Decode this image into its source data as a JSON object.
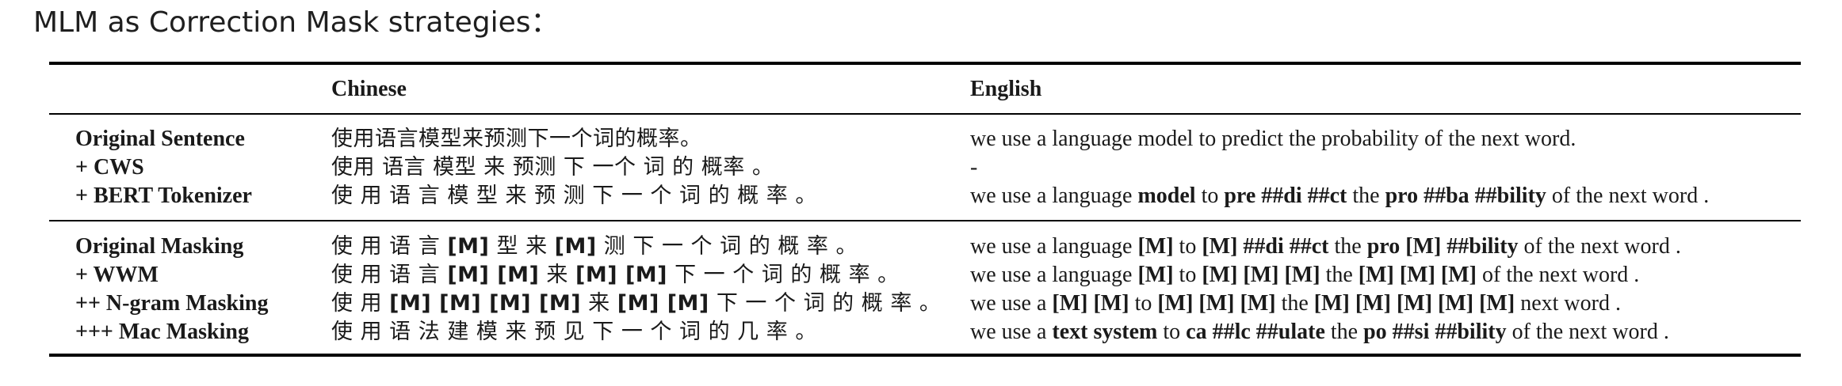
{
  "heading": "MLM as Correction Mask strategies：",
  "table": {
    "headers": {
      "label": "",
      "chinese": "Chinese",
      "english": "English"
    },
    "group1": [
      {
        "label": "Original Sentence",
        "zh": [
          {
            "t": "使用语言模型来预测下一个词的概率。",
            "b": false
          }
        ],
        "en": [
          {
            "t": "we use a language model to predict the probability of the next word.",
            "b": false
          }
        ]
      },
      {
        "label": "+ CWS",
        "zh": [
          {
            "t": "使用 语言 模型 来 预测 下 一个 词 的 概率 。",
            "b": false
          }
        ],
        "en": [
          {
            "t": "-",
            "b": false
          }
        ]
      },
      {
        "label": "+ BERT Tokenizer",
        "zh": [
          {
            "t": "使 用 语 言 模 型 来 预 测 下 一 个 词 的 概 率 。",
            "b": false
          }
        ],
        "en": [
          {
            "t": "we use a language ",
            "b": false
          },
          {
            "t": "model",
            "b": true
          },
          {
            "t": " to ",
            "b": false
          },
          {
            "t": "pre ##di ##ct",
            "b": true
          },
          {
            "t": " the ",
            "b": false
          },
          {
            "t": "pro ##ba ##bility",
            "b": true
          },
          {
            "t": " of the next word .",
            "b": false
          }
        ]
      }
    ],
    "group2": [
      {
        "label": "Original Masking",
        "zh": [
          {
            "t": "使 用 语 言 ",
            "b": false
          },
          {
            "t": "[M]",
            "b": true
          },
          {
            "t": " 型 来 ",
            "b": false
          },
          {
            "t": "[M]",
            "b": true
          },
          {
            "t": " 测 下 一 个 词 的 概 率 。",
            "b": false
          }
        ],
        "en": [
          {
            "t": "we use a language ",
            "b": false
          },
          {
            "t": "[M]",
            "b": true
          },
          {
            "t": " to ",
            "b": false
          },
          {
            "t": "[M] ##di ##ct",
            "b": true
          },
          {
            "t": " the ",
            "b": false
          },
          {
            "t": "pro [M] ##bility",
            "b": true
          },
          {
            "t": " of the next word .",
            "b": false
          }
        ]
      },
      {
        "label": "+ WWM",
        "zh": [
          {
            "t": "使 用 语 言 ",
            "b": false
          },
          {
            "t": "[M] [M]",
            "b": true
          },
          {
            "t": " 来 ",
            "b": false
          },
          {
            "t": "[M] [M]",
            "b": true
          },
          {
            "t": " 下 一 个 词 的 概 率 。",
            "b": false
          }
        ],
        "en": [
          {
            "t": "we use a language ",
            "b": false
          },
          {
            "t": "[M]",
            "b": true
          },
          {
            "t": " to ",
            "b": false
          },
          {
            "t": "[M] [M] [M]",
            "b": true
          },
          {
            "t": " the ",
            "b": false
          },
          {
            "t": "[M] [M] [M]",
            "b": true
          },
          {
            "t": " of the next word .",
            "b": false
          }
        ]
      },
      {
        "label": "++ N-gram Masking",
        "zh": [
          {
            "t": "使 用 ",
            "b": false
          },
          {
            "t": "[M] [M] [M] [M]",
            "b": true
          },
          {
            "t": " 来 ",
            "b": false
          },
          {
            "t": "[M] [M]",
            "b": true
          },
          {
            "t": " 下 一 个 词 的 概 率 。",
            "b": false
          }
        ],
        "en": [
          {
            "t": "we use a ",
            "b": false
          },
          {
            "t": "[M] [M]",
            "b": true
          },
          {
            "t": " to ",
            "b": false
          },
          {
            "t": "[M] [M] [M]",
            "b": true
          },
          {
            "t": " the ",
            "b": false
          },
          {
            "t": "[M] [M] [M] [M] [M]",
            "b": true
          },
          {
            "t": " next word .",
            "b": false
          }
        ]
      },
      {
        "label": "+++ Mac Masking",
        "zh": [
          {
            "t": "使 用 语 法 建 模 来 预 见 下 一 个 词 的 几 率 。",
            "b": false
          }
        ],
        "en": [
          {
            "t": "we use a ",
            "b": false
          },
          {
            "t": "text system",
            "b": true
          },
          {
            "t": " to ",
            "b": false
          },
          {
            "t": "ca ##lc ##ulate",
            "b": true
          },
          {
            "t": " the ",
            "b": false
          },
          {
            "t": "po ##si ##bility",
            "b": true
          },
          {
            "t": " of the next word .",
            "b": false
          }
        ]
      }
    ]
  }
}
